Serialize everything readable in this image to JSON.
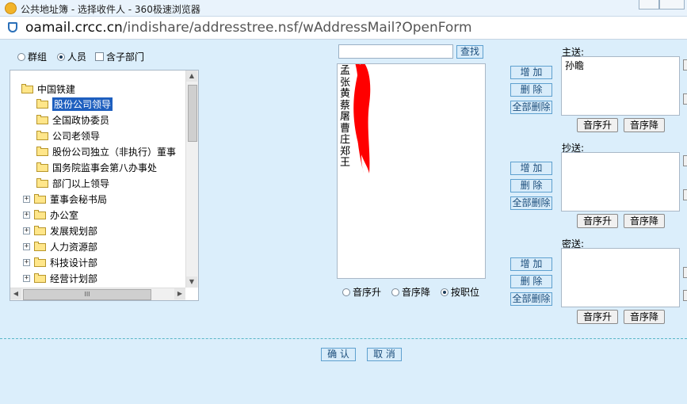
{
  "window": {
    "title": "公共地址簿 - 选择收件人 - 360极速浏览器"
  },
  "address_bar": {
    "url_host": "oamail.crcc.cn",
    "url_path": "/indishare/addresstree.nsf/wAddressMail?OpenForm"
  },
  "mode_options": {
    "group_label": "群组",
    "person_label": "人员",
    "subdept_label": "含子部门",
    "selected": "人员"
  },
  "tree": {
    "root": "中国铁建",
    "items": [
      {
        "label": "股份公司领导",
        "expandable": false,
        "selected": true
      },
      {
        "label": "全国政协委员",
        "expandable": false,
        "selected": false
      },
      {
        "label": "公司老领导",
        "expandable": false,
        "selected": false
      },
      {
        "label": "股份公司独立（非执行）董事",
        "expandable": false,
        "selected": false
      },
      {
        "label": "国务院监事会第八办事处",
        "expandable": false,
        "selected": false
      },
      {
        "label": "部门以上领导",
        "expandable": false,
        "selected": false
      },
      {
        "label": "董事会秘书局",
        "expandable": true,
        "selected": false
      },
      {
        "label": "办公室",
        "expandable": true,
        "selected": false
      },
      {
        "label": "发展规划部",
        "expandable": true,
        "selected": false
      },
      {
        "label": "人力资源部",
        "expandable": true,
        "selected": false
      },
      {
        "label": "科技设计部",
        "expandable": true,
        "selected": false
      },
      {
        "label": "经营计划部",
        "expandable": true,
        "selected": false
      }
    ],
    "hscroll_grip": "III"
  },
  "search": {
    "value": "",
    "button_label": "查找"
  },
  "name_list": {
    "items": [
      "孟",
      "张",
      "黄",
      "蔡",
      "屠",
      "曹",
      "庄",
      "郑",
      "王"
    ]
  },
  "sort_options": {
    "asc_label": "音序升",
    "desc_label": "音序降",
    "position_label": "按职位",
    "selected": "按职位"
  },
  "recipients": {
    "to": {
      "label": "主送:",
      "entries": [
        "孙瞻"
      ],
      "add_label": "增 加",
      "delete_label": "删 除",
      "delete_all_label": "全部删除",
      "asc_label": "音序升",
      "desc_label": "音序降"
    },
    "cc": {
      "label": "抄送:",
      "entries": [],
      "add_label": "增 加",
      "delete_label": "删 除",
      "delete_all_label": "全部删除",
      "asc_label": "音序升",
      "desc_label": "音序降"
    },
    "bcc": {
      "label": "密送:",
      "entries": [],
      "add_label": "增 加",
      "delete_label": "删 除",
      "delete_all_label": "全部删除",
      "asc_label": "音序升",
      "desc_label": "音序降"
    }
  },
  "footer": {
    "confirm_label": "确 认",
    "cancel_label": "取 消"
  },
  "colors": {
    "background": "#dbeefb",
    "button_border": "#5ea0cf",
    "selection": "#1e5fbf",
    "redaction": "#ff0000"
  }
}
